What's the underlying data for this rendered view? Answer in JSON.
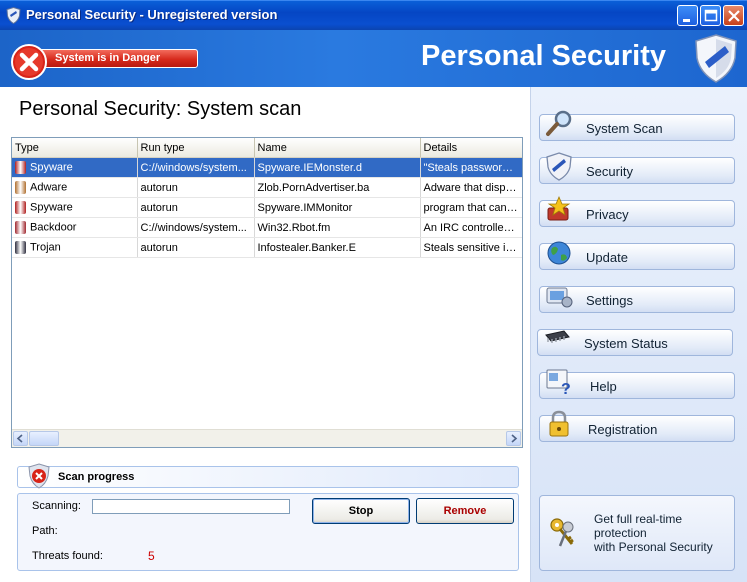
{
  "window": {
    "title": "Personal Security - Unregistered version",
    "icon": "shield-icon"
  },
  "header": {
    "brand": "Personal Security",
    "danger_label": "System is in Danger"
  },
  "main": {
    "title": "Personal Security: System scan",
    "columns": [
      "Type",
      "Run type",
      "Name",
      "Details"
    ],
    "rows": [
      {
        "type": "Spyware",
        "run_type": "C://windows/system...",
        "name": "Spyware.IEMonster.d",
        "details": "\"Steals passwords fr",
        "icon_color": "#b02020",
        "selected": true
      },
      {
        "type": "Adware",
        "run_type": "autorun",
        "name": "Zlob.PornAdvertiser.ba",
        "details": "Adware that displays",
        "icon_color": "#b07030",
        "selected": false
      },
      {
        "type": "Spyware",
        "run_type": "autorun",
        "name": "Spyware.IMMonitor",
        "details": "program that can be",
        "icon_color": "#b02020",
        "selected": false
      },
      {
        "type": "Backdoor",
        "run_type": "C://windows/system...",
        "name": "Win32.Rbot.fm",
        "details": "An IRC controlled ba",
        "icon_color": "#a02830",
        "selected": false
      },
      {
        "type": "Trojan",
        "run_type": "autorun",
        "name": "Infostealer.Banker.E",
        "details": "Steals sensitive infor",
        "icon_color": "#303040",
        "selected": false
      }
    ]
  },
  "scan": {
    "header": "Scan progress",
    "scanning_label": "Scanning:",
    "path_label": "Path:",
    "threats_label": "Threats found:",
    "threats_count": "5",
    "stop_label": "Stop",
    "remove_label": "Remove"
  },
  "sidebar": {
    "items": [
      {
        "label": "System Scan",
        "icon": "magnifier-icon"
      },
      {
        "label": "Security",
        "icon": "shield-icon"
      },
      {
        "label": "Privacy",
        "icon": "privacy-icon"
      },
      {
        "label": "Update",
        "icon": "globe-icon"
      },
      {
        "label": "Settings",
        "icon": "settings-icon"
      },
      {
        "label": "System Status",
        "icon": "chip-icon"
      },
      {
        "label": "Help",
        "icon": "help-icon"
      },
      {
        "label": "Registration",
        "icon": "lock-icon"
      }
    ],
    "promo": {
      "line1": "Get full real-time",
      "line2": "protection",
      "line3": "with Personal Security"
    }
  },
  "colors": {
    "title_bar": "#0a4fd0",
    "header": "#2a7ae0",
    "danger": "#d62a1c",
    "selection": "#316ac5",
    "threats": "#cc0000"
  }
}
